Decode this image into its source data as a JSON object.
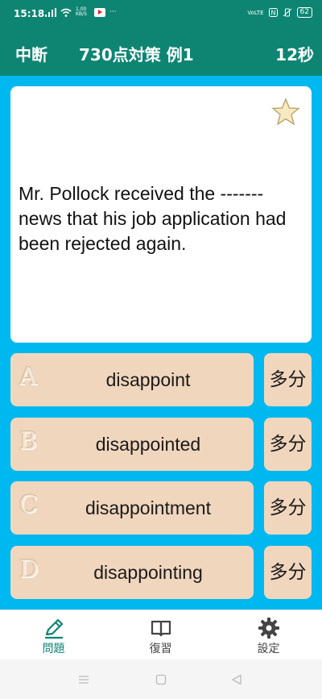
{
  "status_bar": {
    "time": "15:18",
    "net_speed": "1.00 KB/S",
    "right_text": "VoLTE",
    "battery": "62"
  },
  "app_bar": {
    "quit_label": "中断",
    "title": "730点対策 例1",
    "timer": "12秒"
  },
  "question": {
    "text": "Mr. Pollock received the ------- news that his job application had been rejected again.",
    "favorite_icon": "star-icon"
  },
  "choices": [
    {
      "letter": "A",
      "word": "disappoint",
      "multi_label": "多分"
    },
    {
      "letter": "B",
      "word": "disappointed",
      "multi_label": "多分"
    },
    {
      "letter": "C",
      "word": "disappointment",
      "multi_label": "多分"
    },
    {
      "letter": "D",
      "word": "disappointing",
      "multi_label": "多分"
    }
  ],
  "tabs": [
    {
      "label": "問題",
      "icon": "pencil-icon",
      "active": true
    },
    {
      "label": "復習",
      "icon": "book-icon",
      "active": false
    },
    {
      "label": "設定",
      "icon": "gear-icon",
      "active": false
    }
  ],
  "colors": {
    "primary": "#0e8572",
    "background": "#00b8f0",
    "choice": "#f0d6bd"
  }
}
